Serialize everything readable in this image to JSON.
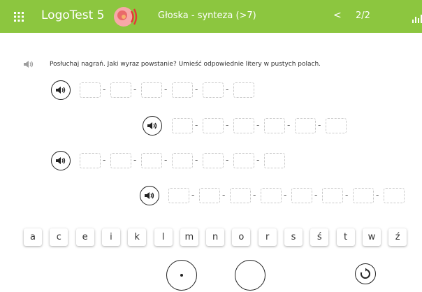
{
  "header": {
    "app_title": "LogoTest 5",
    "exercise_title": "Głoska - synteza (>7)",
    "prev_label": "<",
    "page_counter": "2/2",
    "colors": {
      "bar": "#8cc63f",
      "text": "#ffffff"
    }
  },
  "instruction": "Posłuchaj nagrań. Jaki wyraz powstanie? Umieść odpowiednie litery w pustych polach.",
  "words": [
    {
      "slots": 6
    },
    {
      "slots": 6
    },
    {
      "slots": 7
    },
    {
      "slots": 8
    }
  ],
  "separator": "-",
  "keyboard": {
    "letters": [
      "a",
      "c",
      "e",
      "i",
      "k",
      "l",
      "m",
      "n",
      "o",
      "r",
      "s",
      "ś",
      "t",
      "w",
      "ź"
    ]
  },
  "icons": {
    "menu": "grid-icon",
    "logo": "logotest-logo",
    "stats": "bar-chart-icon",
    "speaker": "speaker-icon",
    "replay": "replay-icon"
  }
}
